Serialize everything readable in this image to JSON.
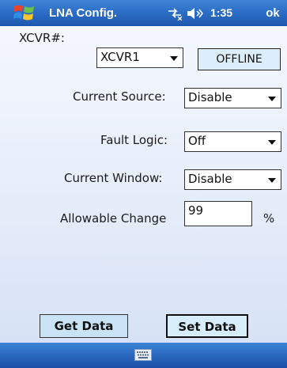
{
  "titlebar": {
    "app_title": "LNA Config.",
    "time": "1:35",
    "ok_label": "ok",
    "icons": [
      "windows-start-icon",
      "connectivity-icon",
      "volume-icon"
    ]
  },
  "form": {
    "xcvr_label": "XCVR#:",
    "xcvr_value": "XCVR1",
    "status": "OFFLINE",
    "current_source_label": "Current Source:",
    "current_source_value": "Disable",
    "fault_logic_label": "Fault Logic:",
    "fault_logic_value": "Off",
    "current_window_label": "Current Window:",
    "current_window_value": "Disable",
    "allowable_change_label": "Allowable Change",
    "allowable_change_value": "99",
    "allowable_change_unit": "%"
  },
  "buttons": {
    "get_data": "Get Data",
    "set_data": "Set Data"
  },
  "bottombar": {
    "icons": [
      "keyboard-icon"
    ]
  },
  "colors": {
    "titlebar_blue": "#2d6fc7",
    "status_box_fill": "#dceefb",
    "button_fill": "#c9e3f4"
  }
}
